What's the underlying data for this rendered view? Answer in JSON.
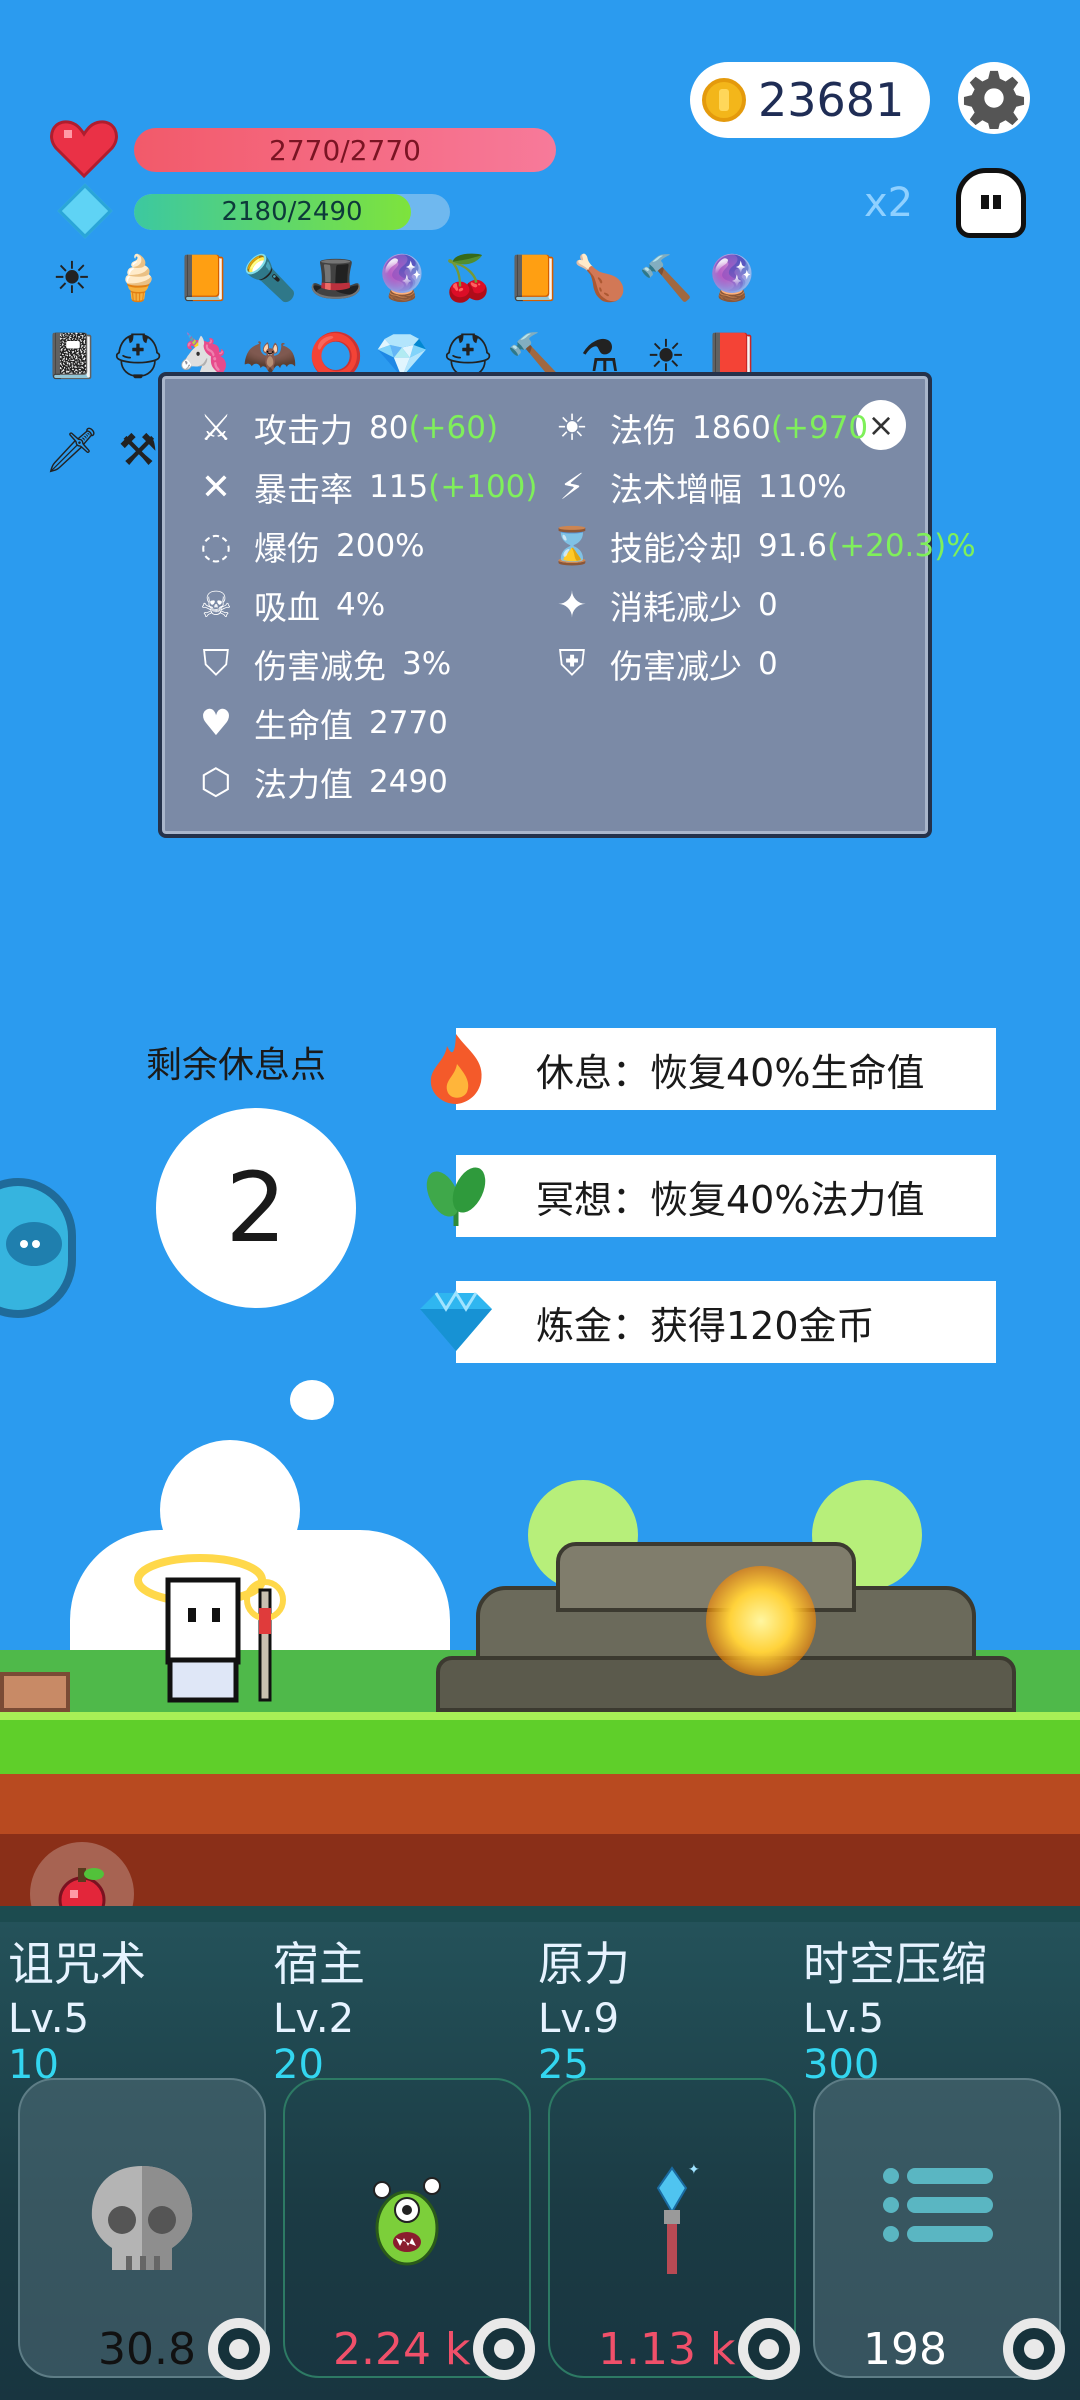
{
  "hud": {
    "coins": "23681",
    "hp_text": "2770/2770",
    "mp_text": "2180/2490",
    "mp_fraction": 0.875,
    "speed_label": "x2"
  },
  "inventory_icons": [
    "sun-orb",
    "ice-cream",
    "spell-book",
    "torch-wand",
    "wizard-hat",
    "crystal-ball",
    "cherries",
    "spell-book",
    "meat-drumstick",
    "hammer",
    "crystal-ball",
    "skull-book",
    "knight-helmet",
    "unicorn",
    "bat",
    "shield-ring",
    "crystal",
    "helmet",
    "hammer",
    "cauldron",
    "sun-orb",
    "tome",
    "dagger",
    "scythe"
  ],
  "stats": {
    "close_label": "×",
    "left": [
      {
        "icon": "axe-icon",
        "label": "攻击力",
        "value": "80",
        "bonus": "(+60)"
      },
      {
        "icon": "crit-icon",
        "label": "暴击率",
        "value": "115",
        "bonus": "(+100)"
      },
      {
        "icon": "burst-icon",
        "label": "爆伤",
        "value": "200%",
        "bonus": ""
      },
      {
        "icon": "vampire-icon",
        "label": "吸血",
        "value": "4%",
        "bonus": ""
      },
      {
        "icon": "shield-icon",
        "label": "伤害减免",
        "value": "3%",
        "bonus": ""
      },
      {
        "icon": "heart-icon",
        "label": "生命值",
        "value": "2770",
        "bonus": ""
      },
      {
        "icon": "hexagon-icon",
        "label": "法力值",
        "value": "2490",
        "bonus": ""
      }
    ],
    "right": [
      {
        "icon": "sun-icon",
        "label": "法伤",
        "value": "1860",
        "bonus": "(+970"
      },
      {
        "icon": "lightning-icon",
        "label": "法术增幅",
        "value": "110%",
        "bonus": ""
      },
      {
        "icon": "hourglass-icon",
        "label": "技能冷却",
        "value": "91.6",
        "bonus": "(+20.3)",
        "suffix": "%"
      },
      {
        "icon": "wand-icon",
        "label": "消耗减少",
        "value": "0",
        "bonus": ""
      },
      {
        "icon": "shield-heart-icon",
        "label": "伤害减少",
        "value": "0",
        "bonus": ""
      }
    ]
  },
  "rest": {
    "label": "剩余休息点",
    "points": "2",
    "options": [
      {
        "icon": "fire-icon",
        "text": "休息：恢复40%生命值"
      },
      {
        "icon": "leaf-icon",
        "text": "冥想：恢复40%法力值"
      },
      {
        "icon": "diamond-icon",
        "text": "炼金：获得120金币"
      }
    ]
  },
  "skills": [
    {
      "name": "诅咒术",
      "level": "Lv.5",
      "cost": "10",
      "cooldown": "30.8",
      "cd_color": "#111111",
      "icon": "skull-icon",
      "dim": true
    },
    {
      "name": "宿主",
      "level": "Lv.2",
      "cost": "20",
      "cooldown": "2.24 k",
      "cd_color": "#f0506a",
      "icon": "monster-icon",
      "dim": false
    },
    {
      "name": "原力",
      "level": "Lv.9",
      "cost": "25",
      "cooldown": "1.13 k",
      "cd_color": "#f0506a",
      "icon": "wand-icon",
      "dim": false
    },
    {
      "name": "时空压缩",
      "level": "Lv.5",
      "cost": "300",
      "cooldown": "198",
      "cd_color": "#ffffff",
      "icon": "list-icon",
      "dim": true
    }
  ]
}
